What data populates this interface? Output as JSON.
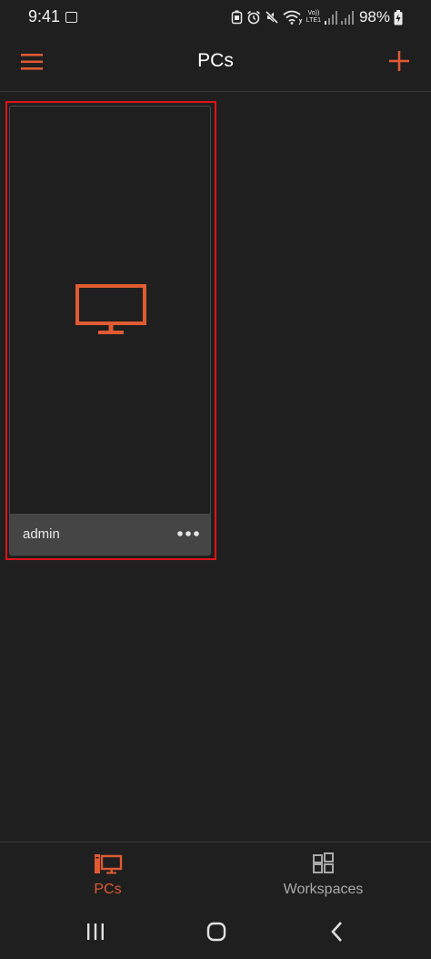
{
  "status_bar": {
    "time": "9:41",
    "volte_top": "Vo))",
    "volte_bottom": "LTE1",
    "battery": "98%"
  },
  "app_bar": {
    "title": "PCs",
    "menu_icon": "hamburger-menu-icon",
    "add_icon": "plus-icon"
  },
  "pcs": [
    {
      "name": "admin",
      "icon": "monitor-icon",
      "more_icon": "more-horizontal-icon"
    }
  ],
  "bottom_nav": {
    "tabs": [
      {
        "label": "PCs",
        "icon": "pc-monitor-icon",
        "active": true
      },
      {
        "label": "Workspaces",
        "icon": "workspaces-grid-icon",
        "active": false
      }
    ]
  },
  "colors": {
    "background": "#1f1f1f",
    "accent": "#e05a32",
    "tile_footer": "#454545",
    "highlight": "#e0121a",
    "inactive": "#a9a9a9"
  }
}
